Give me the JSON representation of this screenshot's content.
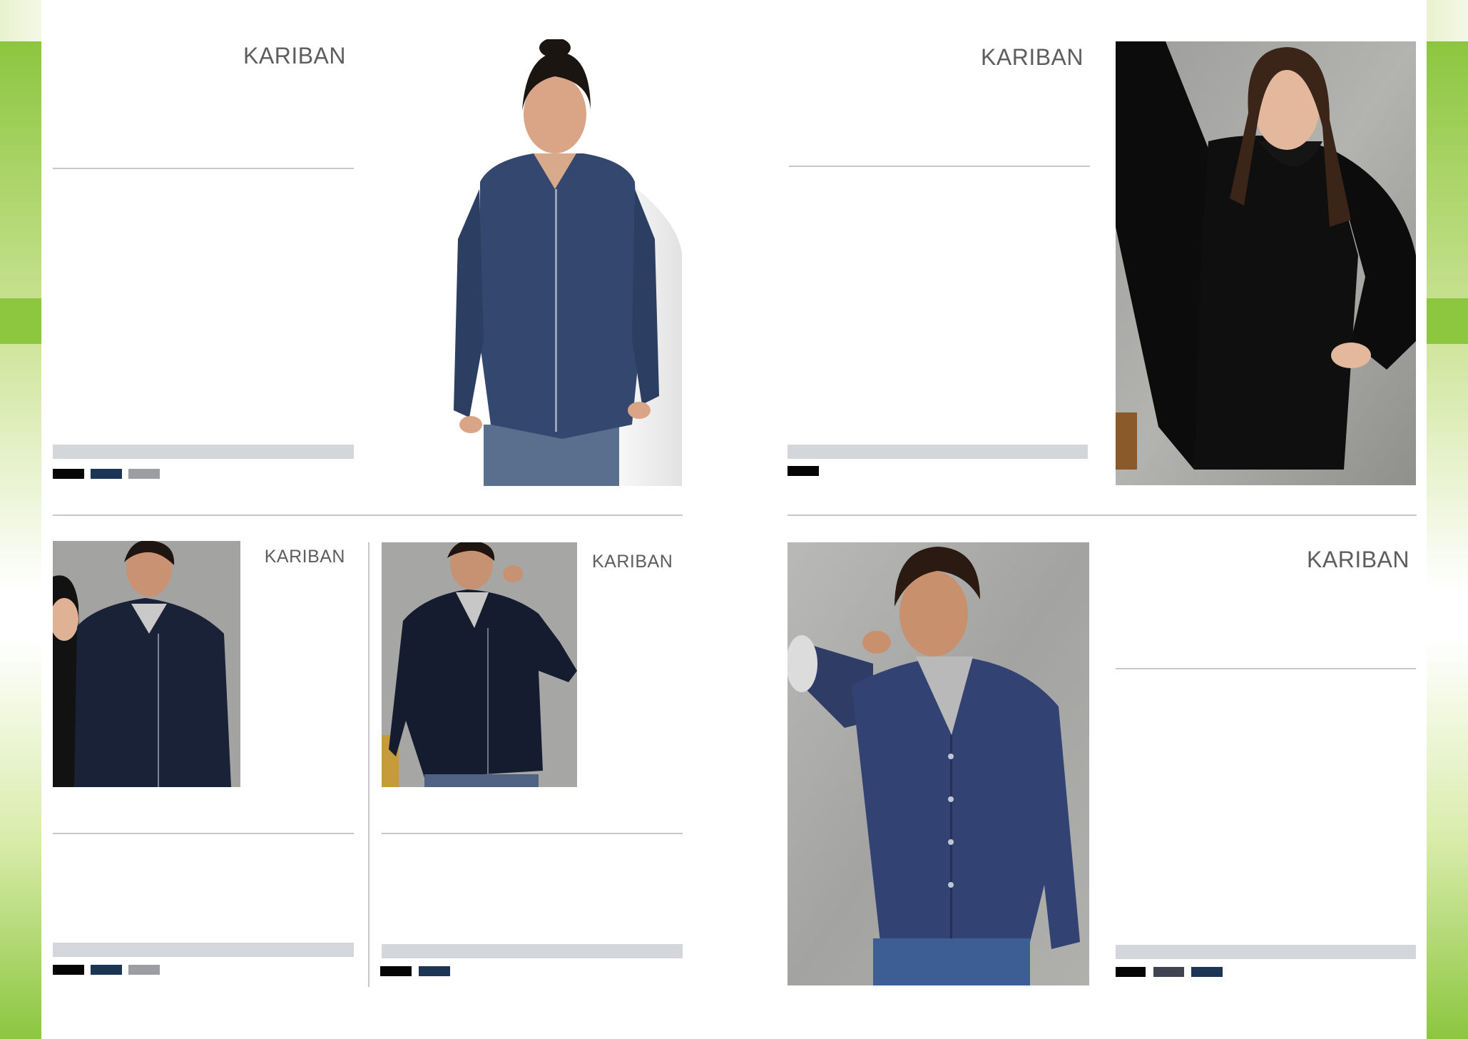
{
  "brand": "KARIBAN",
  "colors": {
    "accent_green": "#8dc63f",
    "swatch_black": "#050505",
    "swatch_navy": "#1c3554",
    "swatch_grey": "#9d9ea2",
    "swatch_charcoal": "#3e4450",
    "band_grey": "#d3d7dc"
  },
  "products": [
    {
      "id": "p1",
      "brand": "KARIBAN",
      "image": "woman-navy-zip-cardigan",
      "swatches": [
        "black",
        "navy",
        "grey"
      ]
    },
    {
      "id": "p2",
      "brand": "KARIBAN",
      "image": "woman-black-button-cardigan",
      "swatches": [
        "black"
      ]
    },
    {
      "id": "p3",
      "brand": "KARIBAN",
      "image": "man-navy-zip-cardigan-with-woman",
      "swatches": [
        "black",
        "navy",
        "grey"
      ]
    },
    {
      "id": "p4",
      "brand": "KARIBAN",
      "image": "man-navy-zip-cardigan",
      "swatches": [
        "black",
        "navy"
      ]
    },
    {
      "id": "p5",
      "brand": "KARIBAN",
      "image": "man-navy-button-cardigan",
      "swatches": [
        "black",
        "charcoal",
        "navy"
      ]
    }
  ]
}
